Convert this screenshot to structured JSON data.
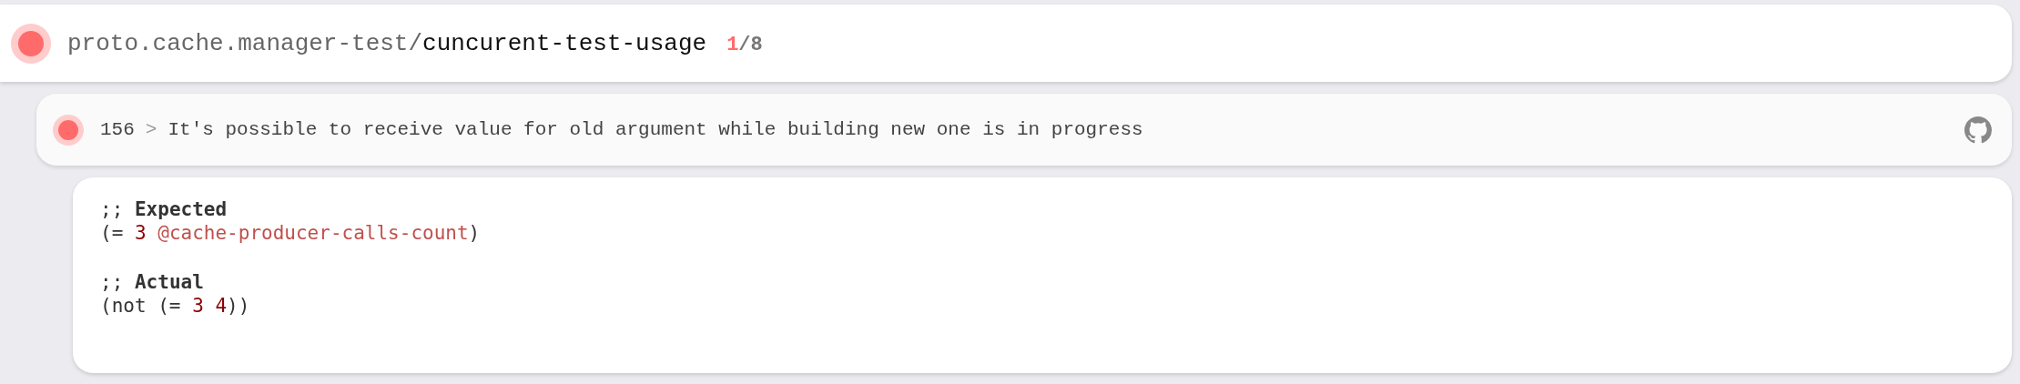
{
  "namespace": {
    "failed": true,
    "prefix": "proto.cache.manager-test/",
    "name": "cuncurent-test-usage",
    "failed_count": "1",
    "total": "/8"
  },
  "assertion": {
    "failed": true,
    "line": "156",
    "separator": ">",
    "message": "It's possible to receive value for old argument while building new one is in progress"
  },
  "report": {
    "blocks": [
      {
        "comment": ";;",
        "heading": "Expected",
        "tokens": [
          {
            "kind": "plain",
            "text": "(= "
          },
          {
            "kind": "number",
            "text": "3 "
          },
          {
            "kind": "symbol",
            "text": "@cache-producer-calls-count"
          },
          {
            "kind": "plain",
            "text": ")"
          }
        ]
      },
      {
        "comment": ";;",
        "heading": "Actual",
        "tokens": [
          {
            "kind": "plain",
            "text": "(not (= "
          },
          {
            "kind": "number",
            "text": "3 "
          },
          {
            "kind": "number",
            "text": "4"
          },
          {
            "kind": "plain",
            "text": "))"
          }
        ]
      }
    ]
  }
}
